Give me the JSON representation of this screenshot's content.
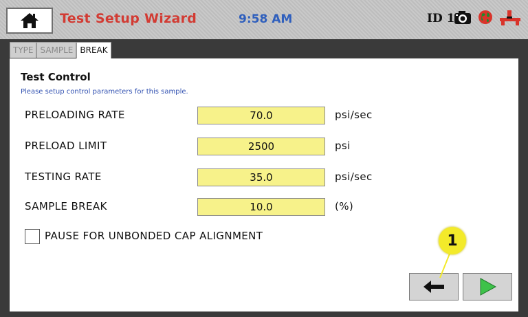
{
  "header": {
    "title": "Test Setup Wizard",
    "time": "9:58 AM",
    "id_label": "ID 1",
    "icons": [
      "home-icon",
      "camera-icon",
      "globe-icon",
      "connector-icon"
    ]
  },
  "tabs": [
    {
      "label": "TYPE",
      "active": false
    },
    {
      "label": "SAMPLE",
      "active": false
    },
    {
      "label": "BREAK",
      "active": true
    }
  ],
  "section": {
    "title": "Test Control",
    "subtitle": "Please setup control parameters for this sample."
  },
  "rows": [
    {
      "label": "PRELOADING RATE",
      "value": "70.0",
      "unit": "psi/sec"
    },
    {
      "label": "PRELOAD LIMIT",
      "value": "2500",
      "unit": "psi"
    },
    {
      "label": "TESTING RATE",
      "value": "35.0",
      "unit": "psi/sec"
    },
    {
      "label": "SAMPLE BREAK",
      "value": "10.0",
      "unit": "(%)"
    }
  ],
  "checkbox": {
    "label": "PAUSE FOR UNBONDED CAP ALIGNMENT",
    "checked": false
  },
  "nav": {
    "back_icon": "arrow-left-icon",
    "next_icon": "play-right-icon"
  },
  "callout": {
    "number": "1"
  },
  "colors": {
    "title": "#d23b33",
    "time": "#2f5fbd",
    "field": "#f7f28a",
    "callout": "#f3ea2a",
    "next_arrow": "#3ec24a"
  }
}
